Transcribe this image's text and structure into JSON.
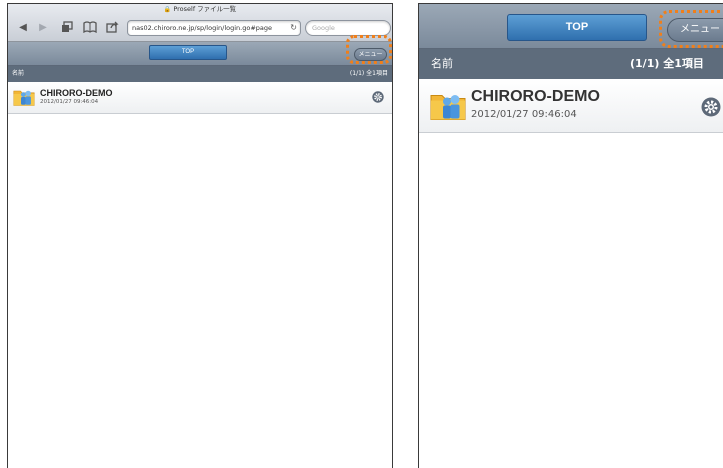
{
  "browser": {
    "lock_icon": "lock-icon",
    "title": "Proself ファイル一覧",
    "back_icon": "back-arrow-icon",
    "forward_icon": "forward-arrow-icon",
    "tabs_icon": "tabs-icon",
    "bookmarks_icon": "bookmarks-icon",
    "share_icon": "share-icon",
    "url": "nas02.chiroro.ne.jp/sp/login/login.go#page",
    "reload_icon": "reload-icon",
    "search_placeholder": "Google"
  },
  "toolbar": {
    "top_label": "TOP",
    "menu_label": "メニュー",
    "highlight_color": "#f07f1a",
    "top_button_color": "#3d82c4"
  },
  "list": {
    "header_name": "名前",
    "header_count": "(1/1) 全1項目",
    "header_count_partial": "(1/1) 全1項目",
    "items": [
      {
        "name": "CHIRORO-DEMO",
        "date": "2012/01/27 09:46:04",
        "icon": "shared-folder-icon",
        "action_icon": "gear-icon"
      }
    ]
  }
}
